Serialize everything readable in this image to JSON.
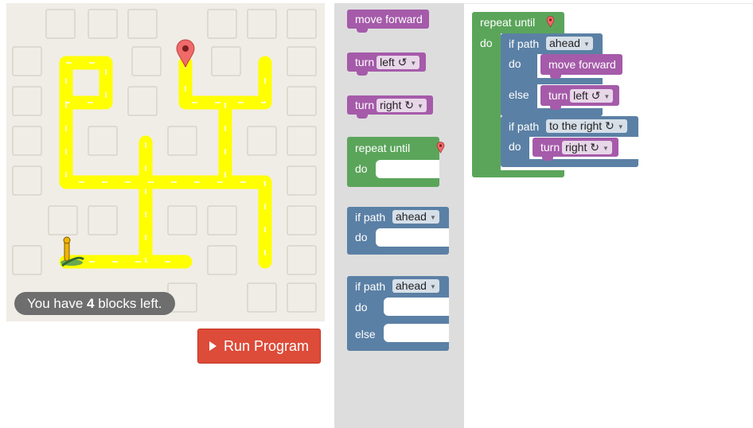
{
  "maze": {
    "blocks_left_prefix": "You have",
    "blocks_left_count": "4",
    "blocks_left_suffix": "blocks left."
  },
  "run_button": {
    "label": "Run Program"
  },
  "toolbox": {
    "move_forward": "move forward",
    "turn_left": {
      "label": "turn",
      "value": "left ↺"
    },
    "turn_right": {
      "label": "turn",
      "value": "right ↻"
    },
    "repeat_until": {
      "label": "repeat until",
      "do": "do"
    },
    "if_path": {
      "label": "if path",
      "value": "ahead",
      "do": "do"
    },
    "if_else": {
      "label": "if path",
      "value": "ahead",
      "do": "do",
      "else": "else"
    }
  },
  "workspace": {
    "repeat_label": "repeat until",
    "repeat_do": "do",
    "if1_label": "if path",
    "if1_value": "ahead",
    "if1_do": "do",
    "if1_move": "move forward",
    "if1_else": "else",
    "if1_turn": "turn",
    "if1_turn_value": "left ↺",
    "if2_label": "if path",
    "if2_value": "to the right ↻",
    "if2_do": "do",
    "if2_turn": "turn",
    "if2_turn_value": "right ↻"
  },
  "colors": {
    "action": "#a55ba9",
    "loop": "#5ba55b",
    "logic": "#5b80a5",
    "run": "#dd4b39",
    "path": "#ffff00"
  }
}
